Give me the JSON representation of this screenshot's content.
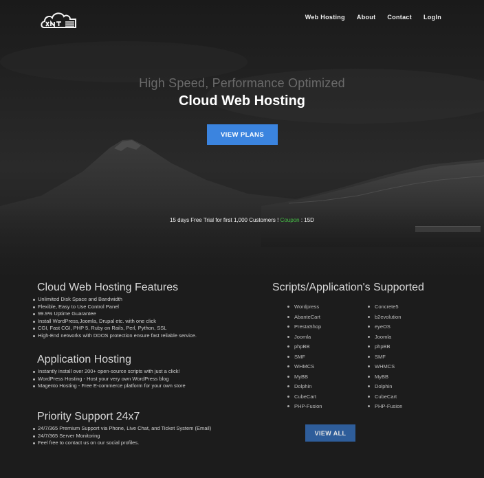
{
  "nav": {
    "items": [
      "Web Hosting",
      "About",
      "Contact",
      "LogIn"
    ]
  },
  "hero": {
    "subtitle": "High Speed, Performance Optimized",
    "title": "Cloud Web Hosting",
    "button": "VIEW PLANS"
  },
  "promo": {
    "text": "15 days Free Trial for first 1,000 Customers ! ",
    "coupon_label": "Coupon",
    "coupon_code": " : 15D"
  },
  "features": {
    "sections": [
      {
        "title": "Cloud Web Hosting Features",
        "items": [
          "Unlimited Disk Space and Bandwidth",
          "Flexible, Easy to Use Control Panel",
          "99.9% Uptime Guarantee",
          "Install WordPress,Joomla, Drupal etc. with one click",
          "CGI, Fast CGI, PHP 5, Ruby on Rails, Perl, Python, SSL",
          "High-End networks with DDOS protection ensure fast reliable service."
        ]
      },
      {
        "title": "Application Hosting",
        "items": [
          "Instantly install over 200+ open-source scripts with just a click!",
          "WordPress Hosting - Host your very own WordPress blog",
          "Magento Hosting - Free E-commerce platform for your own store"
        ]
      },
      {
        "title": "Priority Support 24x7",
        "items": [
          "24/7/365 Premium Support via Phone, Live Chat, and Ticket System (Email)",
          "24/7/365 Server Monitoring",
          "Feel free to contact us on our social profiles."
        ]
      }
    ]
  },
  "scripts": {
    "title": "Scripts/Application's Supported",
    "column_a": [
      "Wordpress",
      "AbanteCart",
      "PrestaShop",
      "Joomla",
      "phpBB",
      "SMF",
      "WHMCS",
      "MyBB",
      "Dolphin",
      "CubeCart",
      "PHP-Fusion"
    ],
    "column_b": [
      "Concrete5",
      "b2evolution",
      "eyeOS",
      "Joomla",
      "phpBB",
      "SMF",
      "WHMCS",
      "MyBB",
      "Dolphin",
      "CubeCart",
      "PHP-Fusion"
    ],
    "button": "VIEW ALL"
  },
  "colors": {
    "primary_button": "#3b84df",
    "secondary_button": "#2e5d9a",
    "coupon": "#46c046",
    "background": "#1c1c1c"
  }
}
